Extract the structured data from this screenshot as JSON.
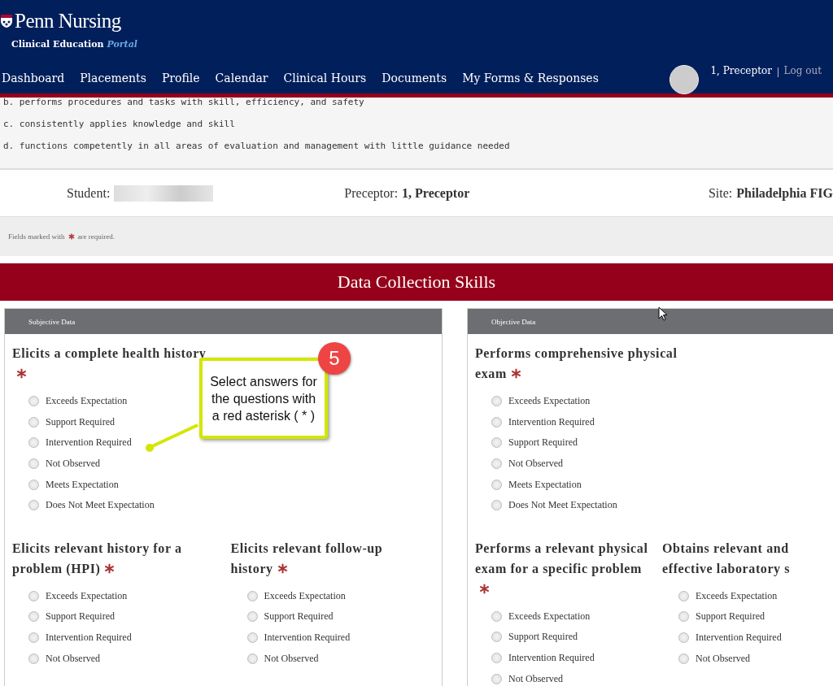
{
  "header": {
    "logo": {
      "title": "Penn Nursing",
      "subtitle": "Clinical Education",
      "subtitle_accent": "Portal"
    },
    "nav": [
      "Dashboard",
      "Placements",
      "Profile",
      "Calendar",
      "Clinical Hours",
      "Documents",
      "My Forms & Responses"
    ],
    "user": {
      "name": "1, Preceptor",
      "separator": "|",
      "logout": "Log out"
    }
  },
  "scale_list": [
    "b. performs procedures and tasks with skill, efficiency, and safety",
    "c. consistently applies knowledge and skill",
    "d. functions competently in all areas of evaluation and management with little guidance needed"
  ],
  "info": {
    "student_label": "Student:",
    "preceptor_label": "Preceptor:",
    "preceptor": "1, Preceptor",
    "site_label": "Site:",
    "site": "Philadelphia FIG"
  },
  "required_note": {
    "before": "Fields marked with",
    "after": "are required."
  },
  "section_title": "Data Collection Skills",
  "panels": [
    {
      "title": "Subjective Data",
      "rows": [
        {
          "questions": [
            {
              "text": "Elicits a complete health history",
              "required": true,
              "options": [
                {
                  "label": "Exceeds Expectation",
                  "selected": false
                },
                {
                  "label": "Support Required",
                  "selected": false
                },
                {
                  "label": "Intervention Required",
                  "selected": false
                },
                {
                  "label": "Not Observed",
                  "selected": false
                },
                {
                  "label": "Meets Expectation",
                  "selected": false
                },
                {
                  "label": "Does Not Meet Expectation",
                  "selected": false
                }
              ]
            }
          ]
        },
        {
          "questions": [
            {
              "text": "Elicits relevant history for a problem (HPI)",
              "required": true,
              "options": [
                {
                  "label": "Exceeds Expectation",
                  "selected": false
                },
                {
                  "label": "Support Required",
                  "selected": false
                },
                {
                  "label": "Intervention Required",
                  "selected": false
                },
                {
                  "label": "Not Observed",
                  "selected": false
                }
              ]
            },
            {
              "text": "Elicits relevant follow-up history",
              "required": true,
              "options": [
                {
                  "label": "Exceeds Expectation",
                  "selected": false
                },
                {
                  "label": "Support Required",
                  "selected": false
                },
                {
                  "label": "Intervention Required",
                  "selected": false
                },
                {
                  "label": "Not Observed",
                  "selected": false
                }
              ]
            }
          ]
        }
      ]
    },
    {
      "title": "Objective Data",
      "rows": [
        {
          "questions": [
            {
              "text": "Performs comprehensive physical exam",
              "required": true,
              "options": [
                {
                  "label": "Exceeds Expectation",
                  "selected": false
                },
                {
                  "label": "Intervention Required",
                  "selected": false
                },
                {
                  "label": "Support Required",
                  "selected": false
                },
                {
                  "label": "Not Observed",
                  "selected": false
                },
                {
                  "label": "Meets Expectation",
                  "selected": false
                },
                {
                  "label": "Does Not Meet Expectation",
                  "selected": false
                }
              ]
            }
          ]
        },
        {
          "questions": [
            {
              "text": "Performs a relevant physical exam for a specific problem",
              "required": true,
              "options": [
                {
                  "label": "Exceeds Expectation",
                  "selected": false
                },
                {
                  "label": "Support Required",
                  "selected": false
                },
                {
                  "label": "Intervention Required",
                  "selected": false
                },
                {
                  "label": "Not Observed",
                  "selected": false
                }
              ]
            },
            {
              "text": "Obtains relevant and effective laboratory s",
              "options": [
                {
                  "label": "Exceeds Expectation",
                  "selected": false
                },
                {
                  "label": "Support Required",
                  "selected": false
                },
                {
                  "label": "Intervention Required",
                  "selected": false
                },
                {
                  "label": "Not Observed",
                  "selected": false
                }
              ]
            }
          ]
        }
      ]
    }
  ],
  "callout": {
    "step": "5",
    "text": "Select answers for the questions with a red asterisk ( * )"
  }
}
